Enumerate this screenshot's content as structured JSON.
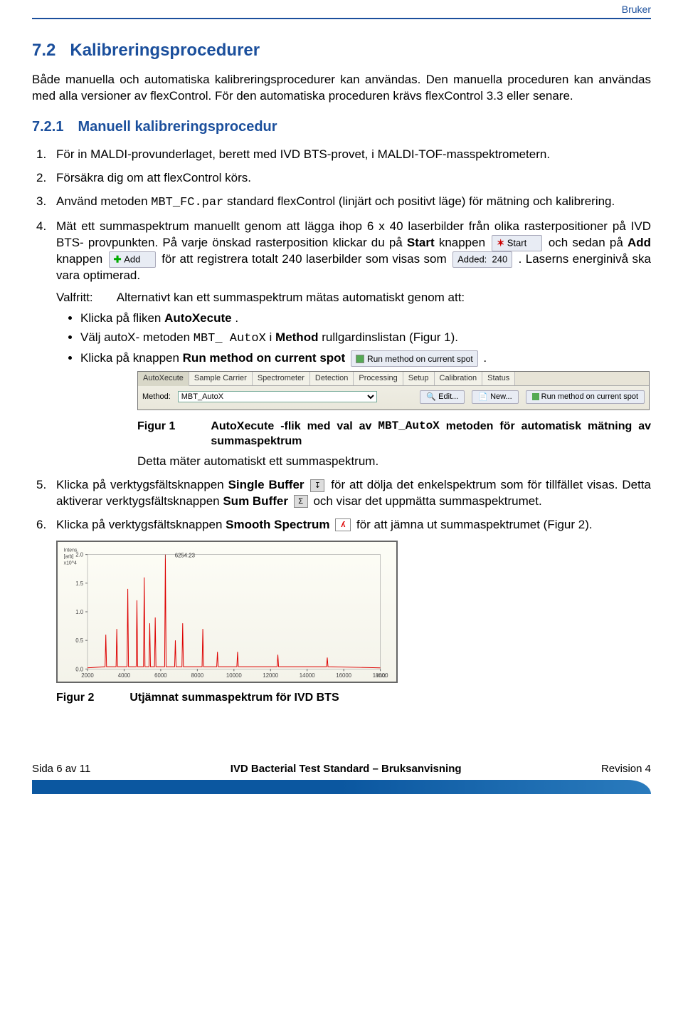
{
  "header": {
    "brand": "Bruker"
  },
  "section72": {
    "number": "7.2",
    "title": "Kalibreringsprocedurer"
  },
  "intro": "Både manuella och automatiska kalibreringsprocedurer kan användas. Den manuella proceduren kan användas med alla versioner av flexControl. För den automatiska proceduren krävs flexControl 3.3 eller senare.",
  "section721": {
    "number": "7.2.1",
    "title": "Manuell kalibreringsprocedur"
  },
  "steps": {
    "s1": "För in MALDI-provunderlaget, berett med IVD BTS-provet, i MALDI-TOF-masspektrometern.",
    "s2": "Försäkra dig om att flexControl körs.",
    "s3_a": "Använd metoden ",
    "s3_code": "MBT_FC.par",
    "s3_b": " standard flexControl (linjärt och positivt läge) för mätning och kalibrering.",
    "s4_a": "Mät ett summaspektrum manuellt genom att lägga ihop 6 x 40 laserbilder från olika rasterpositioner på IVD BTS- provpunkten. På varje önskad rasterposition klickar du på ",
    "s4_b": " knappen ",
    "s4_c": " och sedan på ",
    "s4_d": " knappen ",
    "s4_e": " för att registrera totalt 240 laserbilder som visas som ",
    "s4_f": ". Laserns energinivå ska vara optimerad.",
    "start_bold": "Start",
    "add_bold": "Add",
    "valfritt_label": "Valfritt:",
    "valfritt_text": "Alternativt kan ett summaspektrum mätas automatiskt genom att:",
    "sub1_a": "Klicka på fliken ",
    "sub1_b": "AutoXecute",
    "sub1_c": " .",
    "sub2_a": "Välj autoX- metoden ",
    "sub2_code": "MBT_ AutoX",
    "sub2_b": " i ",
    "sub2_method": "Method",
    "sub2_c": " rullgardinslistan (Figur 1).",
    "sub3_a": "Klicka på knappen ",
    "sub3_b": "Run method on current spot",
    "sub3_c": " .",
    "s5_a": "Klicka på verktygsfältsknappen ",
    "s5_single": "Single Buffer",
    "s5_b": " för att dölja det enkelspektrum som för tillfället visas. Detta aktiverar verktygsfältsknappen ",
    "s5_sum": "Sum Buffer",
    "s5_c": " och visar det uppmätta summaspektrumet.",
    "s6_a": "Klicka på verktygsfältsknappen ",
    "s6_smooth": "Smooth Spectrum",
    "s6_b": " för att jämna ut summaspektrumet (Figur 2)."
  },
  "inline_buttons": {
    "start": "Start",
    "add": "Add",
    "added": "Added:",
    "added_val": "240",
    "run_spot": "Run method on current spot"
  },
  "fig1": {
    "tabs": [
      "AutoXecute",
      "Sample Carrier",
      "Spectrometer",
      "Detection",
      "Processing",
      "Setup",
      "Calibration",
      "Status"
    ],
    "method_label": "Method:",
    "method_value": "MBT_AutoX",
    "edit": "Edit...",
    "new": "New...",
    "run": "Run method on current spot"
  },
  "fig1_caption": {
    "label": "Figur 1",
    "text_a": "AutoXecute -flik med val av ",
    "code": "MBT_AutoX",
    "text_b": " metoden för automatisk mätning av summaspektrum"
  },
  "fig1_after": "Detta mäter automatiskt ett summaspektrum.",
  "fig2_caption": {
    "label": "Figur 2",
    "text": "Utjämnat summaspektrum för IVD BTS"
  },
  "chart_data": {
    "type": "line",
    "title": "",
    "xlabel": "m/z",
    "ylabel": "Intens. [arb] x10^4",
    "xlim": [
      2000,
      18000
    ],
    "ylim": [
      0,
      2
    ],
    "xticks": [
      2000,
      4000,
      6000,
      8000,
      10000,
      12000,
      14000,
      16000,
      18000
    ],
    "yticks": [
      0.0,
      0.5,
      1.0,
      1.5,
      2.0
    ],
    "annotation": {
      "x": 6254.23,
      "y": 2.0,
      "label": "6254.23"
    },
    "peaks": [
      {
        "x": 3000,
        "y": 0.6
      },
      {
        "x": 3600,
        "y": 0.7
      },
      {
        "x": 4200,
        "y": 1.4
      },
      {
        "x": 4700,
        "y": 1.2
      },
      {
        "x": 5100,
        "y": 1.6
      },
      {
        "x": 5400,
        "y": 0.8
      },
      {
        "x": 5700,
        "y": 0.9
      },
      {
        "x": 6254,
        "y": 2.0
      },
      {
        "x": 6800,
        "y": 0.5
      },
      {
        "x": 7200,
        "y": 0.8
      },
      {
        "x": 8300,
        "y": 0.7
      },
      {
        "x": 9100,
        "y": 0.3
      },
      {
        "x": 10200,
        "y": 0.3
      },
      {
        "x": 12400,
        "y": 0.25
      },
      {
        "x": 15100,
        "y": 0.2
      }
    ]
  },
  "footer": {
    "left": "Sida 6 av 11",
    "center": "IVD Bacterial Test Standard – Bruksanvisning",
    "right": "Revision 4"
  }
}
